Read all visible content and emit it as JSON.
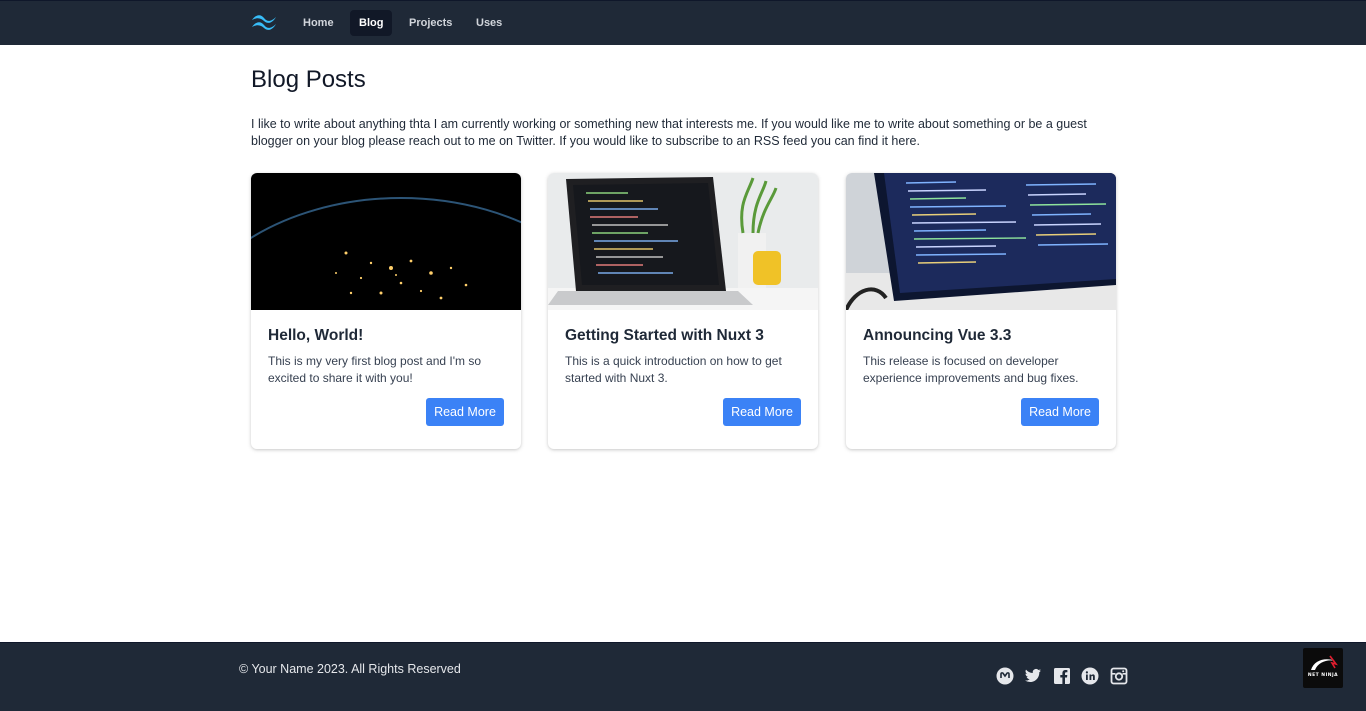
{
  "nav": {
    "logo_icon": "tailwind-logo-icon",
    "links": [
      "Home",
      "Blog",
      "Projects",
      "Uses"
    ],
    "active": "Blog"
  },
  "page": {
    "title": "Blog Posts",
    "intro": "I like to write about anything thta I am currently working or something new that interests me. If you would like me to write about something or be a guest blogger on your blog please reach out to me on Twitter. If you would like to subscribe to an RSS feed you can find it here."
  },
  "posts": [
    {
      "image": "earth-night-lights-image",
      "title": "Hello, World!",
      "description": "This is my very first blog post and I'm so excited to share it with you!",
      "button": "Read More"
    },
    {
      "image": "laptop-code-plant-image",
      "title": "Getting Started with Nuxt 3",
      "description": "This is a quick introduction on how to get started with Nuxt 3.",
      "button": "Read More"
    },
    {
      "image": "monitor-code-image",
      "title": "Announcing Vue 3.3",
      "description": "This release is focused on developer experience improvements and bug fixes.",
      "button": "Read More"
    }
  ],
  "footer": {
    "copyright": "© Your Name 2023. All Rights Reserved",
    "social_icons": [
      "mastodon-icon",
      "twitter-icon",
      "facebook-icon",
      "linkedin-icon",
      "instagram-icon"
    ],
    "badge_text": "NET NINJA"
  },
  "colors": {
    "nav_bg": "#1f2937",
    "accent": "#3b82f6",
    "footer_bg": "#1f2937"
  }
}
